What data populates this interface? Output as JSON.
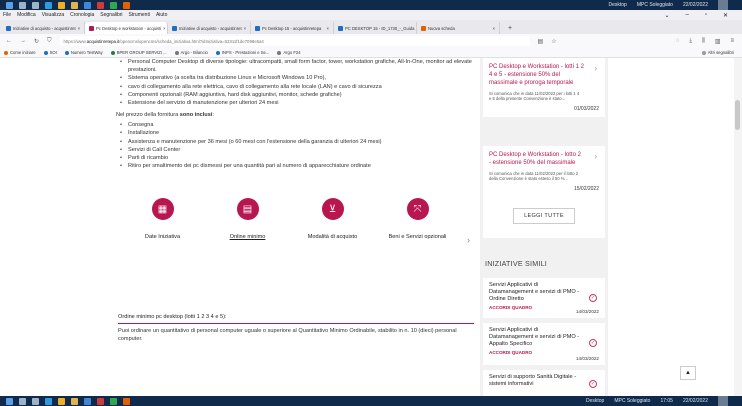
{
  "taskbar": {
    "desktop_label": "Desktop",
    "user_label": "MPC Soleggiato",
    "time": "17:05",
    "date": "22/02/2022"
  },
  "menubar": {
    "items": [
      "File",
      "Modifica",
      "Visualizza",
      "Cronologia",
      "Segnalibri",
      "Strumenti",
      "Aiuto"
    ]
  },
  "tabs": [
    {
      "label": "Iniziative di acquisto - acquistinret",
      "color": "#1a6fc4"
    },
    {
      "label": "Pc Desktop e workstation - acquisti",
      "color": "#b8164f",
      "active": true
    },
    {
      "label": "Iniziative di acquisto - acquistinret",
      "color": "#1a6fc4"
    },
    {
      "label": "Pc Desktop 15 - acquistinretepa",
      "color": "#1a6fc4"
    },
    {
      "label": "PC DESKTOP 15 - ID_1730_-_Guida",
      "color": "#1a6fc4"
    },
    {
      "label": "Nuova scheda",
      "color": "#e66000"
    }
  ],
  "navbar": {
    "url_prefix": "https://www.",
    "url_domain": "acquistinretepa.it",
    "url_rest": "/opencms/opencms/scheda_iniziativa.html?idIniziativa=53311f1de7098e5a4"
  },
  "bookmarks": [
    {
      "label": "Come iniziare",
      "color": "#e66000"
    },
    {
      "label": "SOI",
      "color": "#1a6fc4"
    },
    {
      "label": "Numero TestWay",
      "color": "#1a6fc4"
    },
    {
      "label": "BPER GROUP SERVIZI ...",
      "color": "#2b7a3d"
    },
    {
      "label": "Argo - Bilancio",
      "color": "#777777"
    },
    {
      "label": "INPS - Prestazioni e Se...",
      "color": "#1a6fc4"
    },
    {
      "label": "Argo F24",
      "color": "#777777"
    }
  ],
  "bookmarks_other": "Altri segnalibri",
  "main": {
    "bullets1": [
      "Personal Computer Desktop di diverse tipologie: ultracompatti, small form factor, tower, workstation grafiche, All-In-One, monitor ad elevate prestazioni.",
      "Sistema operativo (a scelta tra distribuzione Linux e Microsoft Windows 10 Pro),",
      "cavo di collegamento alla rete elettrica, cavo di collegamento alla rete locale (LAN) e cavo di sicurezza",
      "Componenti opzionali (RAM aggiuntiva, hard disk aggiuntivi, monitor, schede grafiche)",
      "Estensione del servizio di manutenzione per ulteriori 24 mesi"
    ],
    "included_prefix": "Nel prezzo della fornitura ",
    "included_bold": "sono inclusi",
    "included_suffix": ":",
    "bullets2": [
      "Consegna",
      "Installazione",
      "Assistenza e manutenzione per 36 mesi (o 60 mesi con l'estensione della garanzia di ulteriori 24 mesi)",
      "Servizi di Call Center",
      "Parti di ricambio",
      "Ritiro per smaltimento dei pc dismessi per una quantità pari al numero di apparecchiature ordinate"
    ],
    "icons": [
      {
        "label": "Date Iniziativa",
        "glyph": "▦"
      },
      {
        "label": "Online minimo",
        "glyph": "▤"
      },
      {
        "label": "Modalità di acquisto",
        "glyph": "⊻"
      },
      {
        "label": "Beni e Servizi opzionali",
        "glyph": "⤧"
      }
    ],
    "ord_title": "Ordine minimo pc desktop (lotti 1 2 3 4 e 5):",
    "ord_text": "Puoi ordinare un quantitativo di personal computer uguale o superiore al Quantitativo Minimo Ordinabile, stabilito in n. 10 (dieci) personal computer."
  },
  "side": {
    "cards": [
      {
        "title": "PC Desktop e Workstation - lotti 1 2 4 e 5 - estensione 50% del massimale e proroga temporale",
        "desc": "Si comunica che in data 11/02/2022 per i lotti 1 4 e 5 della presente Convenzione è stato...",
        "date": "01/03/2022"
      },
      {
        "title": "PC Desktop e Workstation - lotto 2 - estensione 50% del massimale",
        "desc": "Si comunica che in data 11/02/2022 per il lotto 2 della Convenzione è stato esteso il 50 %...",
        "date": "15/02/2022"
      }
    ],
    "leggi": "LEGGI TUTTE",
    "similar_head": "INIZIATIVE SIMILI",
    "similar": [
      {
        "title": "Servizi Applicativi di Datamanagement e servizi di PMO - Ordine Diretto",
        "cat": "ACCORDI QUADRO",
        "date": "14/03/2022"
      },
      {
        "title": "Servizi Applicativi di Datamanagement e servizi di PMO - Appalto Specifico",
        "cat": "ACCORDI QUADRO",
        "date": "14/03/2022"
      },
      {
        "title": "Servizi di supporto Sanità Digitale - sistemi informativi",
        "cat": "",
        "date": ""
      }
    ]
  }
}
